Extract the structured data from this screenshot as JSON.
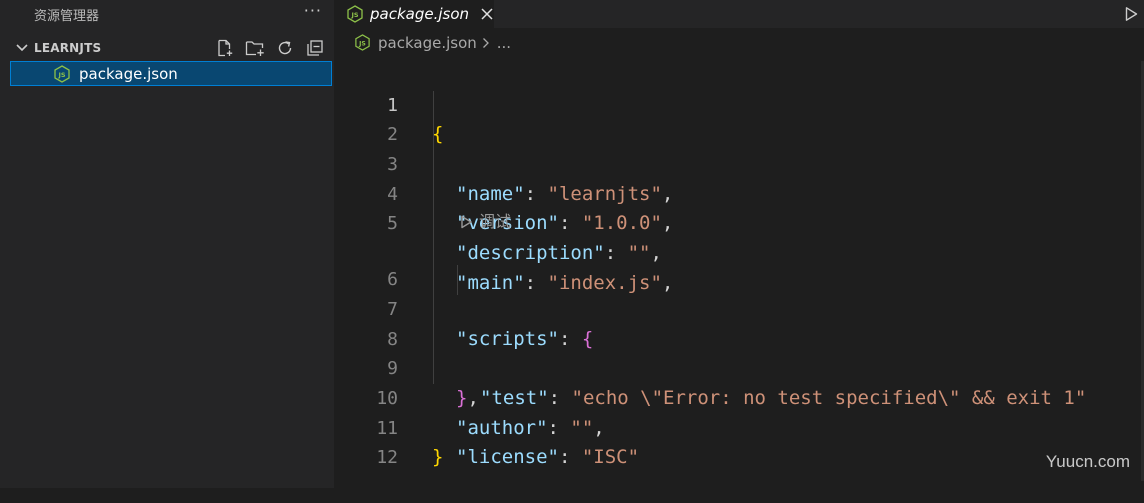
{
  "explorer": {
    "title": "资源管理器",
    "more": "···",
    "folder": "LEARNJTS",
    "file": "package.json"
  },
  "tab": {
    "label": "package.json"
  },
  "breadcrumb": {
    "file": "package.json",
    "ellipsis": "..."
  },
  "codelens": {
    "label": "调试"
  },
  "code": {
    "lines": [
      "1",
      "2",
      "3",
      "4",
      "5",
      "6",
      "7",
      "8",
      "9",
      "10",
      "11",
      "12"
    ],
    "open_brace": "{",
    "close_brace": "}",
    "name_key": "\"name\"",
    "name_val": "\"learnjts\"",
    "version_key": "\"version\"",
    "version_val": "\"1.0.0\"",
    "description_key": "\"description\"",
    "description_val": "\"\"",
    "main_key": "\"main\"",
    "main_val": "\"index.js\"",
    "scripts_key": "\"scripts\"",
    "scripts_open": "{",
    "test_key": "\"test\"",
    "test_val": "\"echo \\\"Error: no test specified\\\" && exit 1\"",
    "scripts_close": "}",
    "author_key": "\"author\"",
    "author_val": "\"\"",
    "license_key": "\"license\"",
    "license_val": "\"ISC\""
  },
  "watermark": "Yuucn.com",
  "colors": {
    "editor_bg": "#1e1e1e",
    "sidebar_bg": "#252526",
    "selection": "#094771",
    "key": "#9cdcfe",
    "string": "#ce9178",
    "bracket_1": "#ffd700",
    "bracket_2": "#da70d6",
    "json_icon": "#8dc149"
  }
}
